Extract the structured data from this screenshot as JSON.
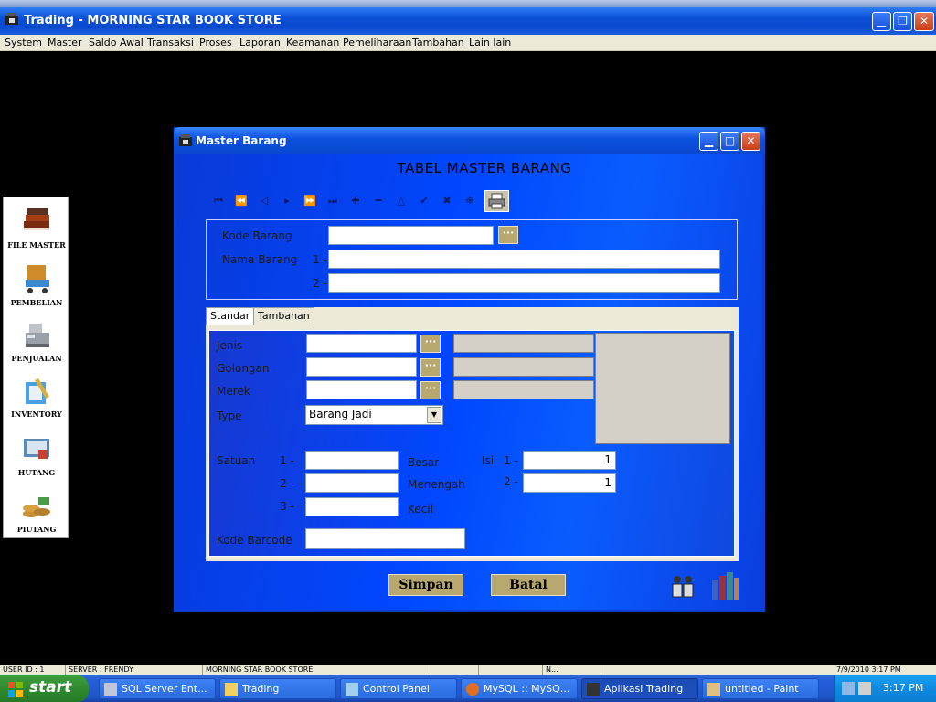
{
  "window": {
    "title": "Trading - MORNING STAR BOOK STORE"
  },
  "menu": [
    "System",
    "Master",
    "Saldo Awal",
    "Transaksi",
    "Proses",
    "Laporan",
    "Keamanan",
    "Pemeliharaan",
    "Tambahan",
    "Lain lain"
  ],
  "left_toolbar": [
    "FILE MASTER",
    "PEMBELIAN",
    "PENJUALAN",
    "INVENTORY",
    "HUTANG",
    "PIUTANG"
  ],
  "child_window": {
    "title": "Master Barang",
    "form_title": "TABEL MASTER BARANG"
  },
  "nav_toolbar": {
    "icons": [
      "first-icon",
      "prior-page-icon",
      "prior-icon",
      "next-icon",
      "next-page-icon",
      "last-icon",
      "insert-icon",
      "delete-icon",
      "edit-icon",
      "post-icon",
      "cancel-icon",
      "refresh-icon",
      "printer-icon"
    ],
    "glyphs": [
      "⏮",
      "⏪",
      "◁",
      "▸",
      "⏩",
      "⏭",
      "✚",
      "━",
      "△",
      "✔",
      "✖",
      "❉"
    ]
  },
  "fields": {
    "kode_barang": {
      "label": "Kode Barang",
      "value": ""
    },
    "nama_barang": {
      "label": "Nama Barang",
      "line1_prefix": "1 -",
      "line2_prefix": "2 -",
      "line1": "",
      "line2": ""
    }
  },
  "tabs": [
    {
      "label": "Standar",
      "active": true
    },
    {
      "label": "Tambahan",
      "active": false
    }
  ],
  "standar": {
    "jenis": {
      "label": "Jenis",
      "value": "",
      "desc": ""
    },
    "golongan": {
      "label": "Golongan",
      "value": "",
      "desc": ""
    },
    "merek": {
      "label": "Merek",
      "value": "",
      "desc": ""
    },
    "type": {
      "label": "Type",
      "selected": "Barang Jadi"
    },
    "satuan": {
      "label": "Satuan",
      "rows": [
        {
          "prefix": "1 -",
          "value": "",
          "name": "Besar"
        },
        {
          "prefix": "2 -",
          "value": "",
          "name": "Menengah"
        },
        {
          "prefix": "3 -",
          "value": "",
          "name": "Kecil"
        }
      ],
      "isi_label": "Isi",
      "isi": [
        {
          "prefix": "1 -",
          "value": "1"
        },
        {
          "prefix": "2 -",
          "value": "1"
        }
      ]
    },
    "kode_barcode": {
      "label": "Kode Barcode",
      "value": ""
    }
  },
  "buttons": {
    "simpan": "Simpan",
    "batal": "Batal"
  },
  "statusbar": [
    "USER ID : 1",
    "SERVER : FRENDY",
    "MORNING STAR BOOK STORE",
    "",
    "",
    "N...",
    "7/9/2010 3:17 PM"
  ],
  "taskbar": {
    "start_label": "start",
    "tasks": [
      {
        "label": "SQL Server Ent...",
        "icon": "sql-server-icon",
        "active": false
      },
      {
        "label": "Trading",
        "icon": "folder-icon",
        "active": false
      },
      {
        "label": "Control Panel",
        "icon": "control-panel-icon",
        "active": false
      },
      {
        "label": "MySQL :: MySQ...",
        "icon": "firefox-icon",
        "active": false
      },
      {
        "label": "Aplikasi Trading",
        "icon": "app-icon",
        "active": true
      },
      {
        "label": "untitled - Paint",
        "icon": "paint-icon",
        "active": false
      }
    ],
    "clock": "3:17 PM"
  },
  "colors": {
    "form_blue": "#0047ff",
    "xp_title": "#0a4fd6",
    "button_gold": "#b8a870"
  }
}
